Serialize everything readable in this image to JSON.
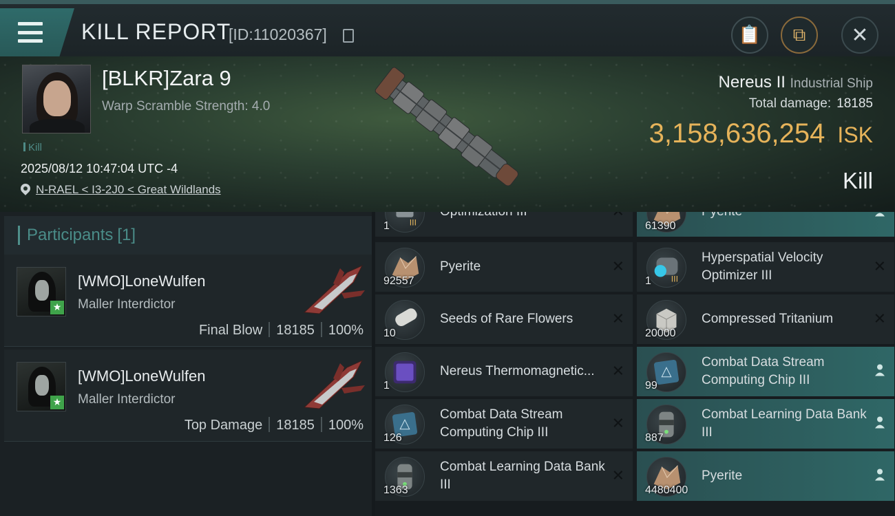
{
  "header": {
    "title": "KILL REPORT",
    "id_text": "[ID:11020367]"
  },
  "victim": {
    "name": "[BLKR]Zara 9",
    "warp_scramble": "Warp Scramble Strength: 4.0",
    "tag": "Kill",
    "datetime": "2025/08/12 10:47:04 UTC -4",
    "location": "N-RAEL < I3-2J0 < Great Wildlands"
  },
  "ship": {
    "name": "Nereus II",
    "class": "Industrial Ship",
    "total_damage_label": "Total damage:",
    "total_damage": "18185",
    "isk_value": "3,158,636,254",
    "isk_unit": "ISK",
    "result": "Kill"
  },
  "participants": {
    "label": "Participants",
    "count": "[1]",
    "rows": [
      {
        "name": "[WMO]LoneWulfen",
        "ship": "Maller Interdictor",
        "role": "Final Blow",
        "damage": "18185",
        "percent": "100%"
      },
      {
        "name": "[WMO]LoneWulfen",
        "ship": "Maller Interdictor",
        "role": "Top Damage",
        "damage": "18185",
        "percent": "100%"
      }
    ]
  },
  "items": [
    {
      "col": 0,
      "qty": "1",
      "name": "Optimization III",
      "icon": "module-icon",
      "highlight": false,
      "status": "destroyed"
    },
    {
      "col": 1,
      "qty": "61390",
      "name": "Pyerite",
      "icon": "pyerite-icon",
      "highlight": true,
      "status": "dropped"
    },
    {
      "col": 0,
      "qty": "92557",
      "name": "Pyerite",
      "icon": "pyerite-icon",
      "highlight": false,
      "status": "destroyed"
    },
    {
      "col": 1,
      "qty": "1",
      "name": "Hyperspatial Velocity Optimizer III",
      "icon": "velocity-optimizer-icon",
      "highlight": false,
      "status": "destroyed"
    },
    {
      "col": 0,
      "qty": "10",
      "name": "Seeds of Rare Flowers",
      "icon": "seeds-icon",
      "highlight": false,
      "status": "destroyed"
    },
    {
      "col": 1,
      "qty": "20000",
      "name": "Compressed Tritanium",
      "icon": "tritanium-icon",
      "highlight": false,
      "status": "destroyed"
    },
    {
      "col": 0,
      "qty": "1",
      "name": "Nereus Thermomagnetic...",
      "icon": "blueprint-icon",
      "highlight": false,
      "status": "destroyed"
    },
    {
      "col": 1,
      "qty": "99",
      "name": "Combat Data Stream Computing Chip III",
      "icon": "chip-icon",
      "highlight": true,
      "status": "dropped"
    },
    {
      "col": 0,
      "qty": "126",
      "name": "Combat Data Stream Computing Chip III",
      "icon": "chip-icon",
      "highlight": false,
      "status": "destroyed"
    },
    {
      "col": 1,
      "qty": "887",
      "name": "Combat Learning Data Bank III",
      "icon": "databank-icon",
      "highlight": true,
      "status": "dropped"
    },
    {
      "col": 0,
      "qty": "1363",
      "name": "Combat Learning Data Bank III",
      "icon": "databank-icon",
      "highlight": false,
      "status": "destroyed"
    },
    {
      "col": 1,
      "qty": "4480400",
      "name": "Pyerite",
      "icon": "pyerite-icon",
      "highlight": true,
      "status": "dropped"
    }
  ],
  "colors": {
    "accent_teal": "#2f6766",
    "isk_gold": "#e6b35a",
    "participant_label": "#4a8c88"
  }
}
